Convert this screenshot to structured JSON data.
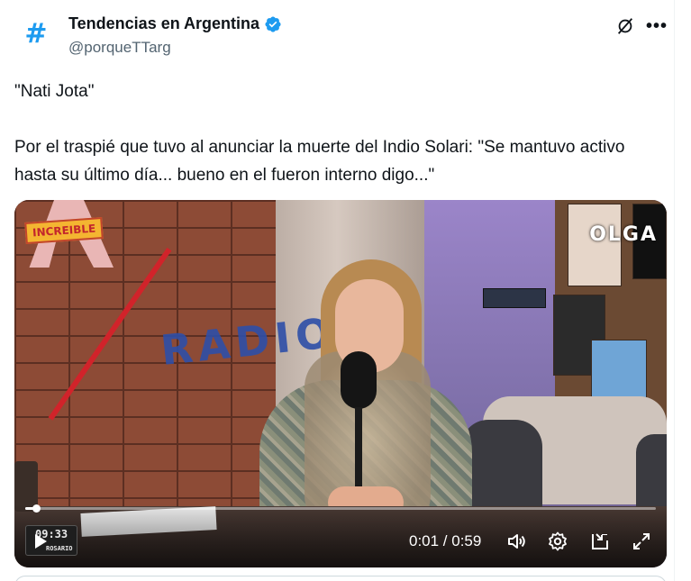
{
  "author": {
    "display_name": "Tendencias en Argentina",
    "handle": "@porqueTTarg",
    "avatar_glyph": "#",
    "verified": true,
    "accent_color": "#1d9bf0"
  },
  "header_icons": {
    "grok": "grok-icon",
    "more": "•••"
  },
  "tweet": {
    "text": "\"Nati Jota\"\n\nPor el traspié que tuvo al anunciar la muerte del Indio Solari: \"Se mantuvo activo hasta su último día... bueno en el fueron interno digo...\""
  },
  "video": {
    "scene_labels": {
      "logo_badge": "INCREIBLE",
      "wall_sign": "RADIO",
      "channel_watermark": "OLGA"
    },
    "clock": {
      "time": "09:33",
      "city": "ROSARIO"
    },
    "player": {
      "current_time": "0:01",
      "duration": "0:59",
      "time_display": "0:01 / 0:59",
      "progress_fraction": 0.017,
      "icons": [
        "play-icon",
        "volume-icon",
        "settings-icon",
        "dock-icon",
        "fullscreen-icon"
      ]
    }
  }
}
